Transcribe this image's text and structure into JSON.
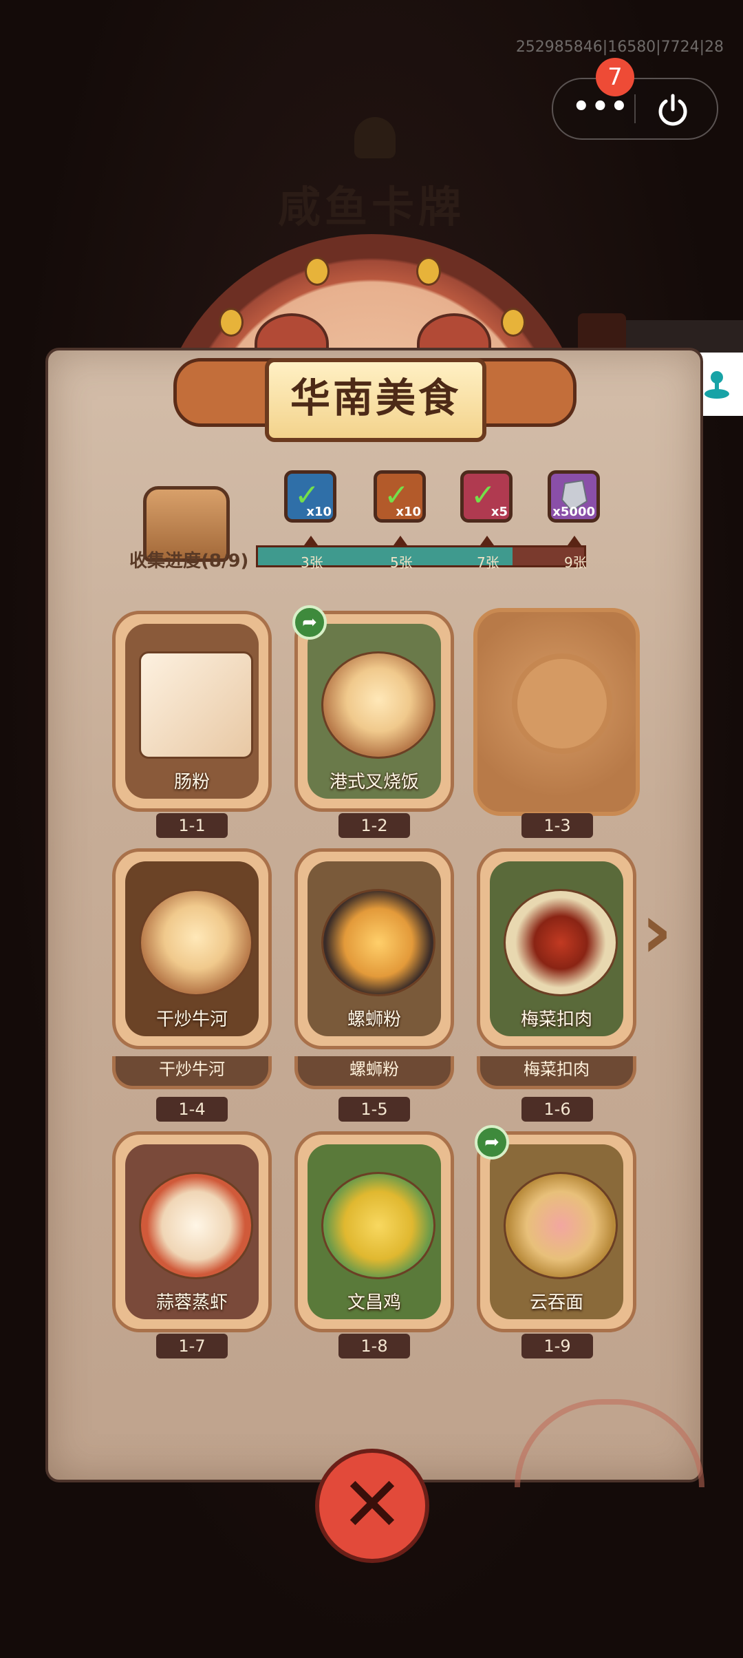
{
  "status": {
    "id_text": "252985846|16580|7724|28"
  },
  "capsule": {
    "badge_count": "7",
    "more_label": "•••"
  },
  "background": {
    "game_title": "咸鱼卡牌"
  },
  "collection": {
    "title": "华南美食",
    "progress_label": "收集进度(8/9)",
    "progress_fraction": 0.78,
    "rewards": [
      {
        "icon": "ticket-check-icon",
        "count": "x10",
        "color": "#2f6fa8"
      },
      {
        "icon": "scroll-check-icon",
        "count": "x10",
        "color": "#b35a2a"
      },
      {
        "icon": "orb-check-icon",
        "count": "x5",
        "color": "#b03a50"
      },
      {
        "icon": "crystal-icon",
        "count": "x5000",
        "color": "#8a4fa8"
      }
    ],
    "milestones": [
      "3张",
      "5张",
      "7张",
      "9张"
    ]
  },
  "cards": [
    {
      "name": "肠粉",
      "code": "1-1",
      "share": false
    },
    {
      "name": "港式叉烧饭",
      "code": "1-2",
      "share": true
    },
    {
      "name": "",
      "code": "1-3",
      "share": false,
      "locked": true
    },
    {
      "name": "干炒牛河",
      "code": "1-4",
      "share": false
    },
    {
      "name": "螺蛳粉",
      "code": "1-5",
      "share": false
    },
    {
      "name": "梅菜扣肉",
      "code": "1-6",
      "share": false
    },
    {
      "name": "蒜蓉蒸虾",
      "code": "1-7",
      "share": false
    },
    {
      "name": "文昌鸡",
      "code": "1-8",
      "share": false
    },
    {
      "name": "云吞面",
      "code": "1-9",
      "share": true
    }
  ],
  "duplicate_strip": [
    "干炒牛河",
    "螺蛳粉",
    "梅菜扣肉"
  ]
}
